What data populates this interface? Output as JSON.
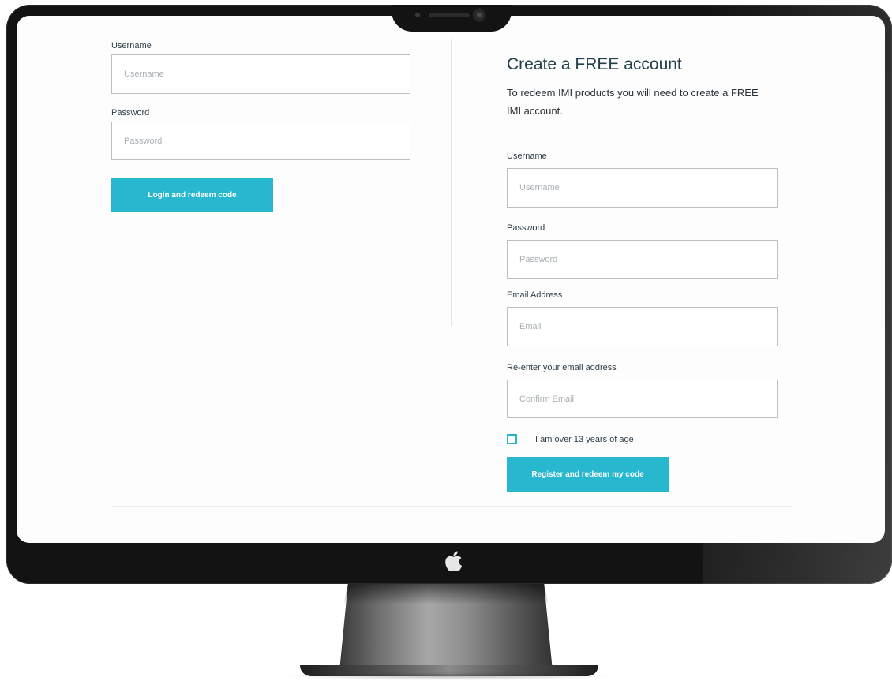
{
  "login_form": {
    "username_label": "Username",
    "username_placeholder": "Username",
    "username_value": "",
    "password_label": "Password",
    "password_placeholder": "Password",
    "password_value": "",
    "submit_label": "Login and redeem code"
  },
  "register_form": {
    "title": "Create a FREE account",
    "intro": "To redeem IMI products you will need to create a FREE IMI account.",
    "username_label": "Username",
    "username_placeholder": "Username",
    "username_value": "",
    "password_label": "Password",
    "password_placeholder": "Password",
    "password_value": "",
    "email_label": "Email Address",
    "email_placeholder": "Email",
    "email_value": "",
    "confirm_email_label": "Re-enter your email address",
    "confirm_email_placeholder": "Confirm Email",
    "confirm_email_value": "",
    "age_checkbox_label": "I am over 13 years of age",
    "age_checkbox_checked": false,
    "submit_label": "Register and redeem my code"
  },
  "device": {
    "logo_icon": "apple-logo-icon"
  },
  "colors": {
    "accent": "#27b7cf",
    "field_border": "#b9c1c6",
    "heading": "#24404c",
    "bezel": "#131313"
  }
}
